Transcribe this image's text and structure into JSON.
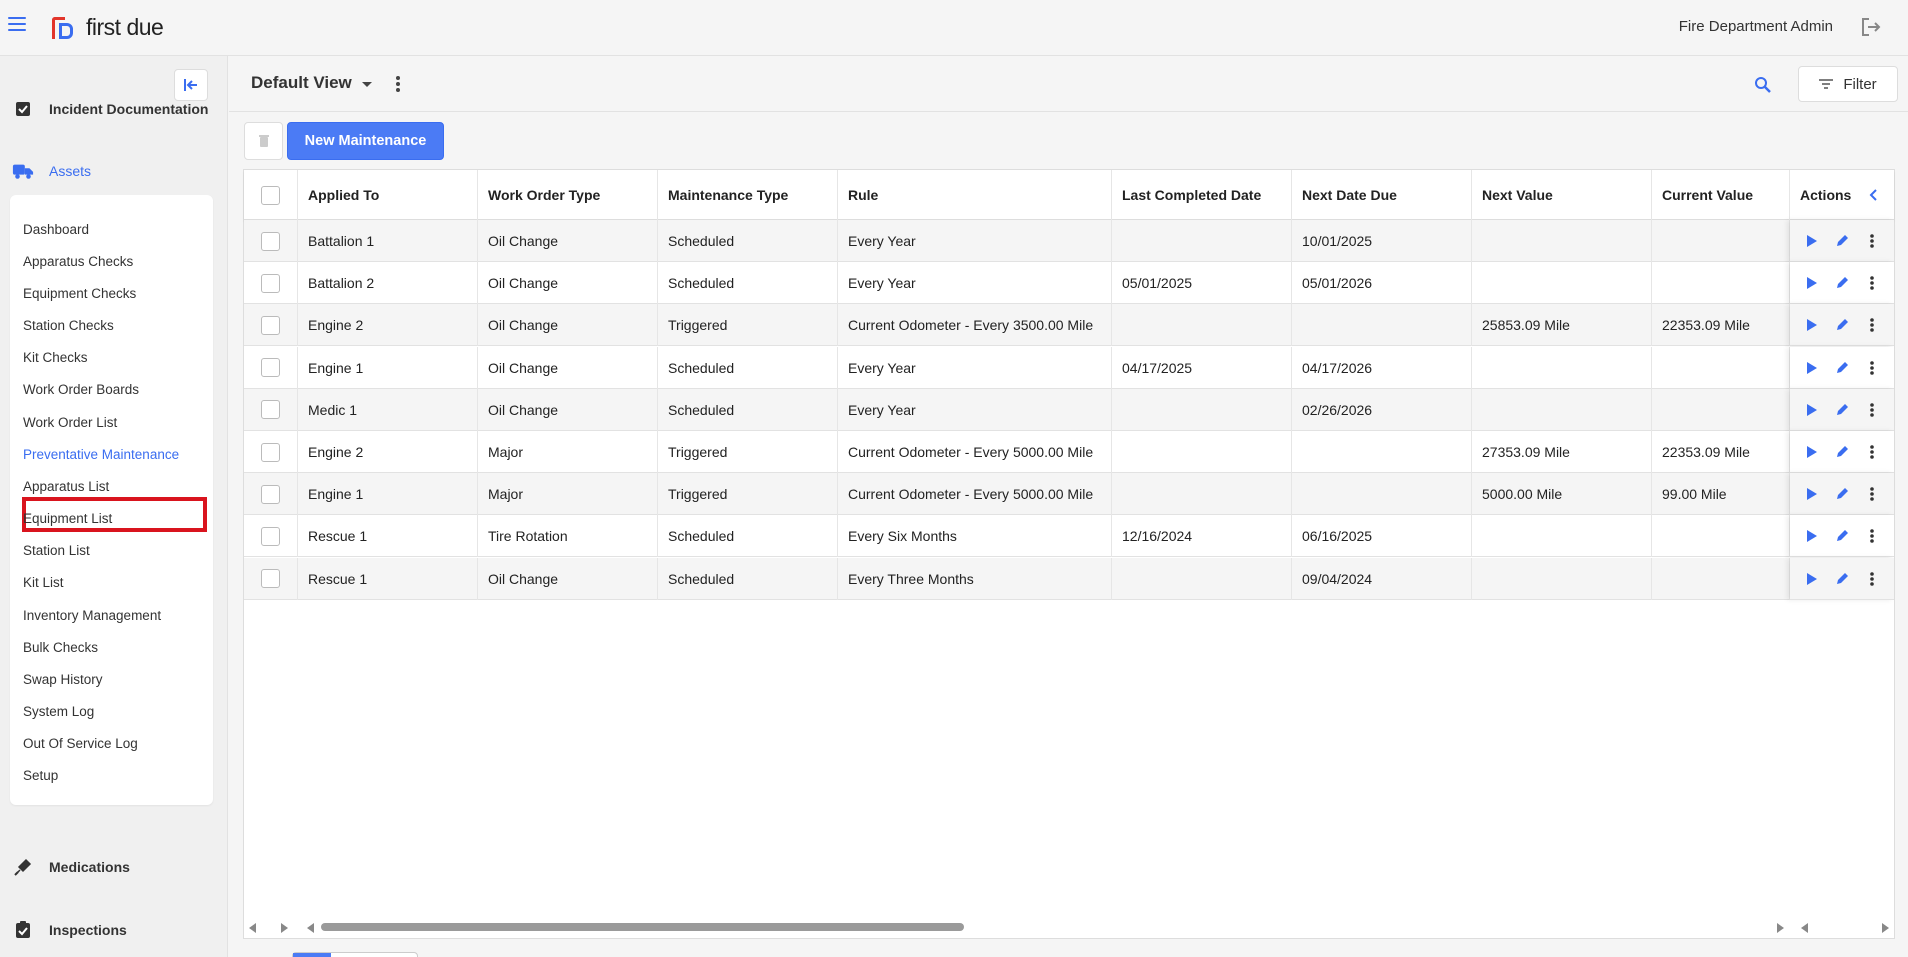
{
  "header": {
    "logo_text": "first due",
    "user_name": "Fire Department Admin"
  },
  "sidebar": {
    "sections": [
      {
        "label": "Incident Documentation",
        "icon": "checkbox-icon"
      },
      {
        "label": "Assets",
        "icon": "truck-icon"
      },
      {
        "label": "Medications",
        "icon": "syringe-icon"
      },
      {
        "label": "Inspections",
        "icon": "clipboard-check-icon"
      }
    ],
    "asset_items": [
      "Dashboard",
      "Apparatus Checks",
      "Equipment Checks",
      "Station Checks",
      "Kit Checks",
      "Work Order Boards",
      "Work Order List",
      "Preventative Maintenance",
      "Apparatus List",
      "Equipment List",
      "Station List",
      "Kit List",
      "Inventory Management",
      "Bulk Checks",
      "Swap History",
      "System Log",
      "Out Of Service Log",
      "Setup"
    ],
    "active_item": "Preventative Maintenance"
  },
  "view": {
    "title": "Default View",
    "filter_label": "Filter"
  },
  "toolbar": {
    "new_label": "New Maintenance"
  },
  "table": {
    "columns": [
      "Applied To",
      "Work Order Type",
      "Maintenance Type",
      "Rule",
      "Last Completed Date",
      "Next Date Due",
      "Next Value",
      "Current Value",
      "Actions"
    ],
    "rows": [
      [
        "Battalion 1",
        "Oil Change",
        "Scheduled",
        "Every Year",
        "",
        "10/01/2025",
        "",
        ""
      ],
      [
        "Battalion 2",
        "Oil Change",
        "Scheduled",
        "Every Year",
        "05/01/2025",
        "05/01/2026",
        "",
        ""
      ],
      [
        "Engine 2",
        "Oil Change",
        "Triggered",
        "Current Odometer - Every 3500.00 Mile",
        "",
        "",
        "25853.09 Mile",
        "22353.09 Mile"
      ],
      [
        "Engine 1",
        "Oil Change",
        "Scheduled",
        "Every Year",
        "04/17/2025",
        "04/17/2026",
        "",
        ""
      ],
      [
        "Medic 1",
        "Oil Change",
        "Scheduled",
        "Every Year",
        "",
        "02/26/2026",
        "",
        ""
      ],
      [
        "Engine 2",
        "Major",
        "Triggered",
        "Current Odometer - Every 5000.00 Mile",
        "",
        "",
        "27353.09 Mile",
        "22353.09 Mile"
      ],
      [
        "Engine 1",
        "Major",
        "Triggered",
        "Current Odometer - Every 5000.00 Mile",
        "",
        "",
        "5000.00 Mile",
        "99.00 Mile"
      ],
      [
        "Rescue 1",
        "Tire Rotation",
        "Scheduled",
        "Every Six Months",
        "12/16/2024",
        "06/16/2025",
        "",
        ""
      ],
      [
        "Rescue 1",
        "Oil Change",
        "Scheduled",
        "Every Three Months",
        "",
        "09/04/2024",
        "",
        ""
      ]
    ]
  },
  "colors": {
    "accent": "#3a6df0",
    "button": "#4b7bf5",
    "highlight_box": "#d9141e",
    "logo_red": "#e2352b"
  }
}
